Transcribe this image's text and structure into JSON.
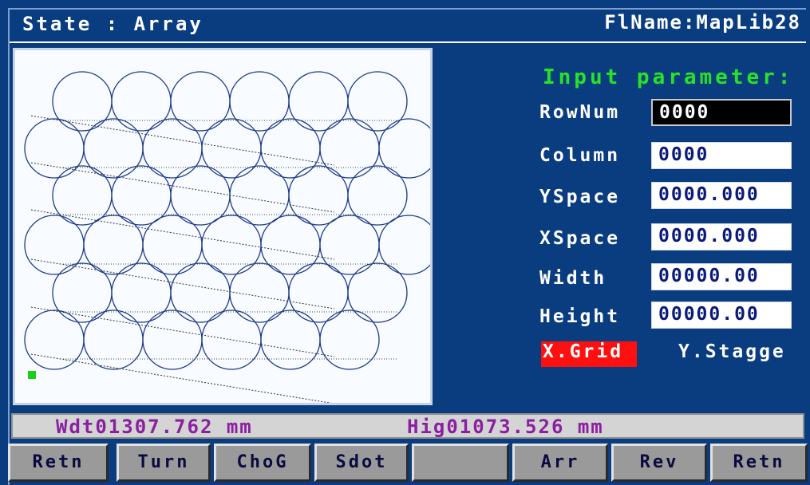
{
  "header": {
    "state": "State : Array",
    "file_name": "FlName:MapLib28"
  },
  "preview": {
    "circle_color": "#1d3a8a",
    "rows": [
      6,
      7,
      6,
      7,
      6,
      6
    ],
    "origin_marker_color": "#18d018"
  },
  "params": {
    "title": "Input parameter:",
    "fields": [
      {
        "label": "RowNum",
        "value": "0000",
        "active": true
      },
      {
        "label": "Column",
        "value": "0000",
        "active": false
      },
      {
        "label": "YSpace",
        "value": "0000.000",
        "active": false
      },
      {
        "label": "XSpace",
        "value": "0000.000",
        "active": false
      },
      {
        "label": "Width",
        "value": "00000.00",
        "active": false
      },
      {
        "label": "Height",
        "value": "00000.00",
        "active": false
      }
    ],
    "mode_selected": "X.Grid",
    "mode_other": "Y.Stagge"
  },
  "status": {
    "width_text": "Wdt01307.762 mm",
    "height_text": "Hig01073.526 mm"
  },
  "fkeys": [
    "Retn",
    "Turn",
    "ChoG",
    "Sdot",
    "",
    "Arr",
    "Rev",
    "Retn"
  ],
  "colors": {
    "background": "#0a3d80",
    "title_green": "#27e327",
    "selected_red": "#ff1010",
    "status_text": "#8a1fa0"
  }
}
